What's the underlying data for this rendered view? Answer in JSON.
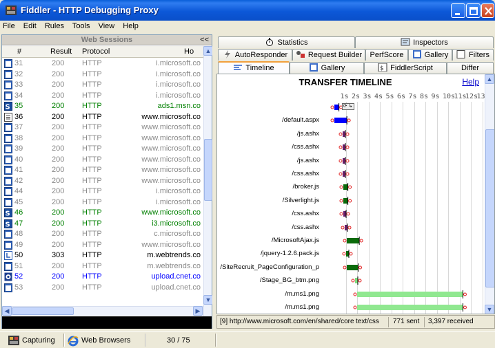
{
  "window": {
    "title": "Fiddler - HTTP Debugging Proxy"
  },
  "menu": [
    "File",
    "Edit",
    "Rules",
    "Tools",
    "View",
    "Help"
  ],
  "sessions": {
    "header": "Web Sessions",
    "collapse": "<<",
    "columns": {
      "num": "#",
      "result": "Result",
      "protocol": "Protocol",
      "host": "Ho"
    },
    "rows": [
      {
        "num": "31",
        "result": "200",
        "protocol": "HTTP",
        "host": "i.microsoft.co",
        "color": "gray",
        "icon": "page"
      },
      {
        "num": "32",
        "result": "200",
        "protocol": "HTTP",
        "host": "i.microsoft.co",
        "color": "gray",
        "icon": "page"
      },
      {
        "num": "33",
        "result": "200",
        "protocol": "HTTP",
        "host": "i.microsoft.co",
        "color": "gray",
        "icon": "page"
      },
      {
        "num": "34",
        "result": "200",
        "protocol": "HTTP",
        "host": "i.microsoft.co",
        "color": "gray",
        "icon": "page"
      },
      {
        "num": "35",
        "result": "200",
        "protocol": "HTTP",
        "host": "ads1.msn.co",
        "color": "green",
        "icon": "script"
      },
      {
        "num": "36",
        "result": "200",
        "protocol": "HTTP",
        "host": "www.microsoft.co",
        "color": "black",
        "icon": "doc"
      },
      {
        "num": "37",
        "result": "200",
        "protocol": "HTTP",
        "host": "www.microsoft.co",
        "color": "gray",
        "icon": "page"
      },
      {
        "num": "38",
        "result": "200",
        "protocol": "HTTP",
        "host": "www.microsoft.co",
        "color": "gray",
        "icon": "page"
      },
      {
        "num": "39",
        "result": "200",
        "protocol": "HTTP",
        "host": "www.microsoft.co",
        "color": "gray",
        "icon": "page"
      },
      {
        "num": "40",
        "result": "200",
        "protocol": "HTTP",
        "host": "www.microsoft.co",
        "color": "gray",
        "icon": "page"
      },
      {
        "num": "41",
        "result": "200",
        "protocol": "HTTP",
        "host": "www.microsoft.co",
        "color": "gray",
        "icon": "page"
      },
      {
        "num": "42",
        "result": "200",
        "protocol": "HTTP",
        "host": "www.microsoft.co",
        "color": "gray",
        "icon": "page"
      },
      {
        "num": "44",
        "result": "200",
        "protocol": "HTTP",
        "host": "i.microsoft.co",
        "color": "gray",
        "icon": "page"
      },
      {
        "num": "45",
        "result": "200",
        "protocol": "HTTP",
        "host": "i.microsoft.co",
        "color": "gray",
        "icon": "page"
      },
      {
        "num": "46",
        "result": "200",
        "protocol": "HTTP",
        "host": "www.microsoft.co",
        "color": "green",
        "icon": "script"
      },
      {
        "num": "47",
        "result": "200",
        "protocol": "HTTP",
        "host": "i3.microsoft.co",
        "color": "green",
        "icon": "script"
      },
      {
        "num": "48",
        "result": "200",
        "protocol": "HTTP",
        "host": "c.microsoft.co",
        "color": "gray",
        "icon": "page"
      },
      {
        "num": "49",
        "result": "200",
        "protocol": "HTTP",
        "host": "www.microsoft.co",
        "color": "gray",
        "icon": "page"
      },
      {
        "num": "50",
        "result": "303",
        "protocol": "HTTP",
        "host": "m.webtrends.co",
        "color": "black",
        "icon": "redirect"
      },
      {
        "num": "51",
        "result": "200",
        "protocol": "HTTP",
        "host": "m.webtrends.co",
        "color": "gray",
        "icon": "page"
      },
      {
        "num": "52",
        "result": "200",
        "protocol": "HTTP",
        "host": "upload.cnet.co",
        "color": "blue",
        "icon": "image"
      },
      {
        "num": "53",
        "result": "200",
        "protocol": "HTTP",
        "host": "upload.cnet.co",
        "color": "gray",
        "icon": "page"
      }
    ]
  },
  "tabs": {
    "row1": [
      "Statistics",
      "Inspectors"
    ],
    "row2": [
      "AutoResponder",
      "Request Builder",
      "PerfScore",
      "Gallery",
      "Filters"
    ],
    "row3": [
      "Timeline",
      "Gallery",
      "FiddlerScript",
      "Differ"
    ]
  },
  "timeline": {
    "title": "TRANSFER TIMELINE",
    "help": "Help",
    "ticks": [
      "1s",
      "2s",
      "3s",
      "4s",
      "5s",
      "6s",
      "7s",
      "8s",
      "9s",
      "10s",
      "11s",
      "12s",
      "13"
    ],
    "rows": [
      {
        "label": "",
        "start": 0.0,
        "end": 0.4,
        "color": "#0000ff",
        "icons": true
      },
      {
        "label": "/default.aspx",
        "start": 0.0,
        "end": 1.1,
        "color": "#0000ff"
      },
      {
        "label": "/js.ashx",
        "start": 0.7,
        "end": 0.8,
        "color": "#6a1f6a"
      },
      {
        "label": "/css.ashx",
        "start": 0.7,
        "end": 0.8,
        "color": "#6a1f6a"
      },
      {
        "label": "/js.ashx",
        "start": 0.7,
        "end": 0.8,
        "color": "#6a1f6a"
      },
      {
        "label": "/css.ashx",
        "start": 0.7,
        "end": 0.8,
        "color": "#6a1f6a"
      },
      {
        "label": "/broker.js",
        "start": 0.8,
        "end": 1.2,
        "color": "#0a6a0a"
      },
      {
        "label": "/Silverlight.js",
        "start": 0.8,
        "end": 1.2,
        "color": "#0a6a0a"
      },
      {
        "label": "/css.ashx",
        "start": 0.8,
        "end": 1.0,
        "color": "#6a1f6a"
      },
      {
        "label": "/css.ashx",
        "start": 0.9,
        "end": 1.1,
        "color": "#6a1f6a"
      },
      {
        "label": "/MicrosoftAjax.js",
        "start": 1.1,
        "end": 2.2,
        "color": "#0a6a0a"
      },
      {
        "label": "/jquery-1.2.6.pack.js",
        "start": 1.0,
        "end": 1.2,
        "color": "#0a6a0a"
      },
      {
        "label": "/SiteRecruit_PageConfiguration_p",
        "start": 1.1,
        "end": 2.1,
        "color": "#0a6a0a"
      },
      {
        "label": "/Stage_BG_btm.png",
        "start": 1.8,
        "end": 1.9,
        "color": "#7fdc7f"
      },
      {
        "label": "/m.ms1.png",
        "start": 2.0,
        "end": 11.3,
        "color": "#90e890"
      },
      {
        "label": "/m.ms1.png",
        "start": 2.0,
        "end": 11.3,
        "color": "#90e890"
      }
    ]
  },
  "status": {
    "url": "[9] http://www.microsoft.com/en/shared/core",
    "type": "text/css",
    "sent": "771 sent",
    "received": "3,397 received"
  },
  "statusbar": {
    "capturing": "Capturing",
    "browsers": "Web Browsers",
    "count": "30 / 75"
  }
}
